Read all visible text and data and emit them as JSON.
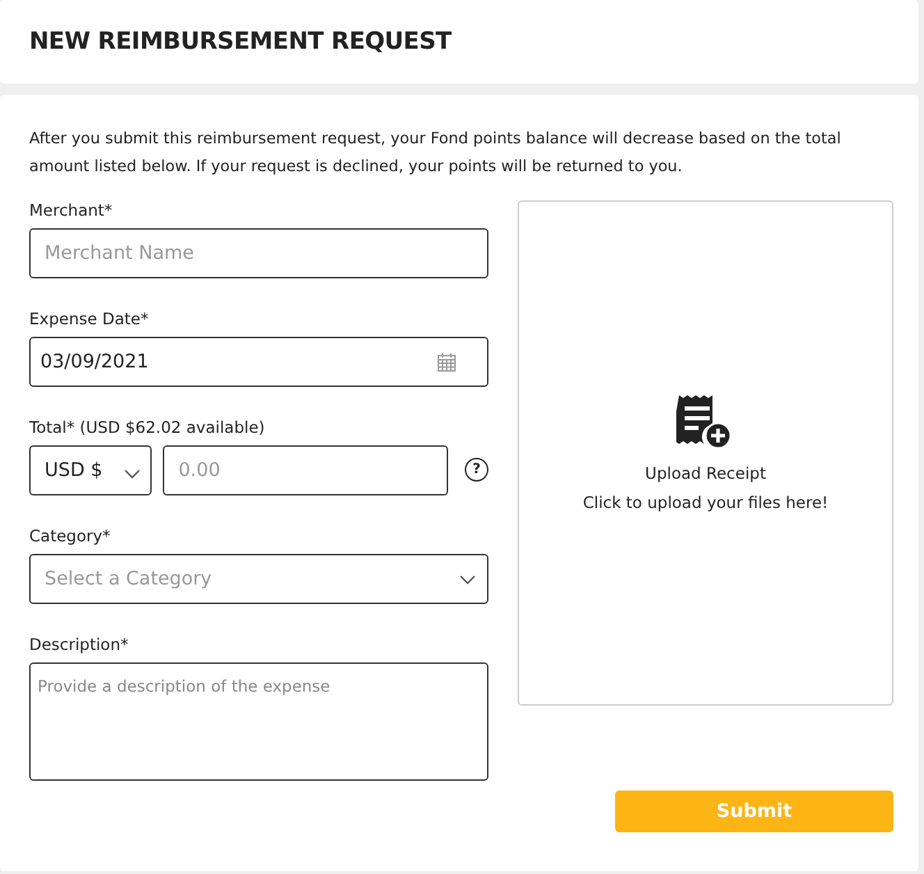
{
  "header": {
    "title": "NEW REIMBURSEMENT REQUEST"
  },
  "intro": "After you submit this reimbursement request, your Fond points balance will decrease based on the total amount listed below. If your request is declined, your points will be returned to you.",
  "merchant": {
    "label": "Merchant*",
    "placeholder": "Merchant Name"
  },
  "expense_date": {
    "label": "Expense Date*",
    "value": "03/09/2021"
  },
  "total": {
    "label": "Total* (USD $62.02 available)",
    "currency": "USD $",
    "placeholder": "0.00",
    "help": "?"
  },
  "category": {
    "label": "Category*",
    "placeholder": "Select a Category"
  },
  "description": {
    "label": "Description*",
    "placeholder": "Provide a description of the expense"
  },
  "upload": {
    "title": "Upload Receipt",
    "hint": "Click to upload your files here!"
  },
  "submit": "Submit"
}
